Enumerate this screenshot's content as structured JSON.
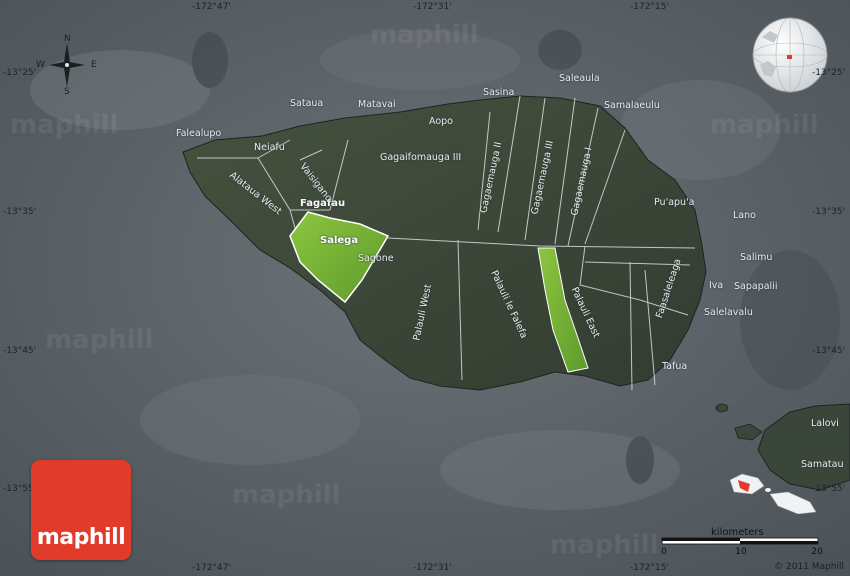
{
  "coordinates": {
    "top": [
      "-172°47'",
      "-172°31'",
      "-172°15'"
    ],
    "bottom": [
      "-172°47'",
      "-172°31'",
      "-172°15'"
    ],
    "left": [
      "-13°25'",
      "-13°35'",
      "-13°45'",
      "-13°55'"
    ],
    "right": [
      "-13°25'",
      "-13°35'",
      "-13°45'",
      "-13°55'"
    ]
  },
  "compass": {
    "n": "N",
    "s": "S",
    "e": "E",
    "w": "W"
  },
  "places": {
    "falealupo": "Falealupo",
    "neiafu": "Neiafu",
    "sataua": "Sataua",
    "matavai": "Matavai",
    "aopo": "Aopo",
    "sasina": "Sasina",
    "saleaula": "Saleaula",
    "samalaeulu": "Samalaeulu",
    "fagafau": "Fagafau",
    "sagone": "Sagone",
    "puapua": "Pu'apu'a",
    "lano": "Lano",
    "salimu": "Salimu",
    "iva": "Iva",
    "sapapalii": "Sapapalii",
    "salelavalu": "Salelavalu",
    "tafua": "Tafua",
    "lalovi": "Lalovi",
    "samatau": "Samatau"
  },
  "districts": {
    "alataua_west": "Alataua West",
    "vaisigano": "Vaisigano",
    "gagaifomauga_iii": "Gagaifomauga III",
    "gagaemauga_ii": "Gagaemauga II",
    "gagaemauga_iii": "Gagaemauga III",
    "gagaemauga_i": "Gagaemauga I",
    "salega": "Salega",
    "palauli_west": "Palauli West",
    "palauli_le_falefa": "Palauli le Falefa",
    "palauli_east": "Palauli East",
    "faasaleleaga": "Faasaleleaga"
  },
  "highlighted_district": "Salega",
  "scale": {
    "title": "kilometers",
    "ticks": [
      "0",
      "10",
      "20"
    ]
  },
  "logo": "maphill",
  "watermark": "maphill",
  "copyright": "© 2011 Maphill",
  "colors": {
    "ocean": "#5d6469",
    "land": "#3e4a3c",
    "highlight": "#7cb83a",
    "logo": "#e13b2b"
  }
}
